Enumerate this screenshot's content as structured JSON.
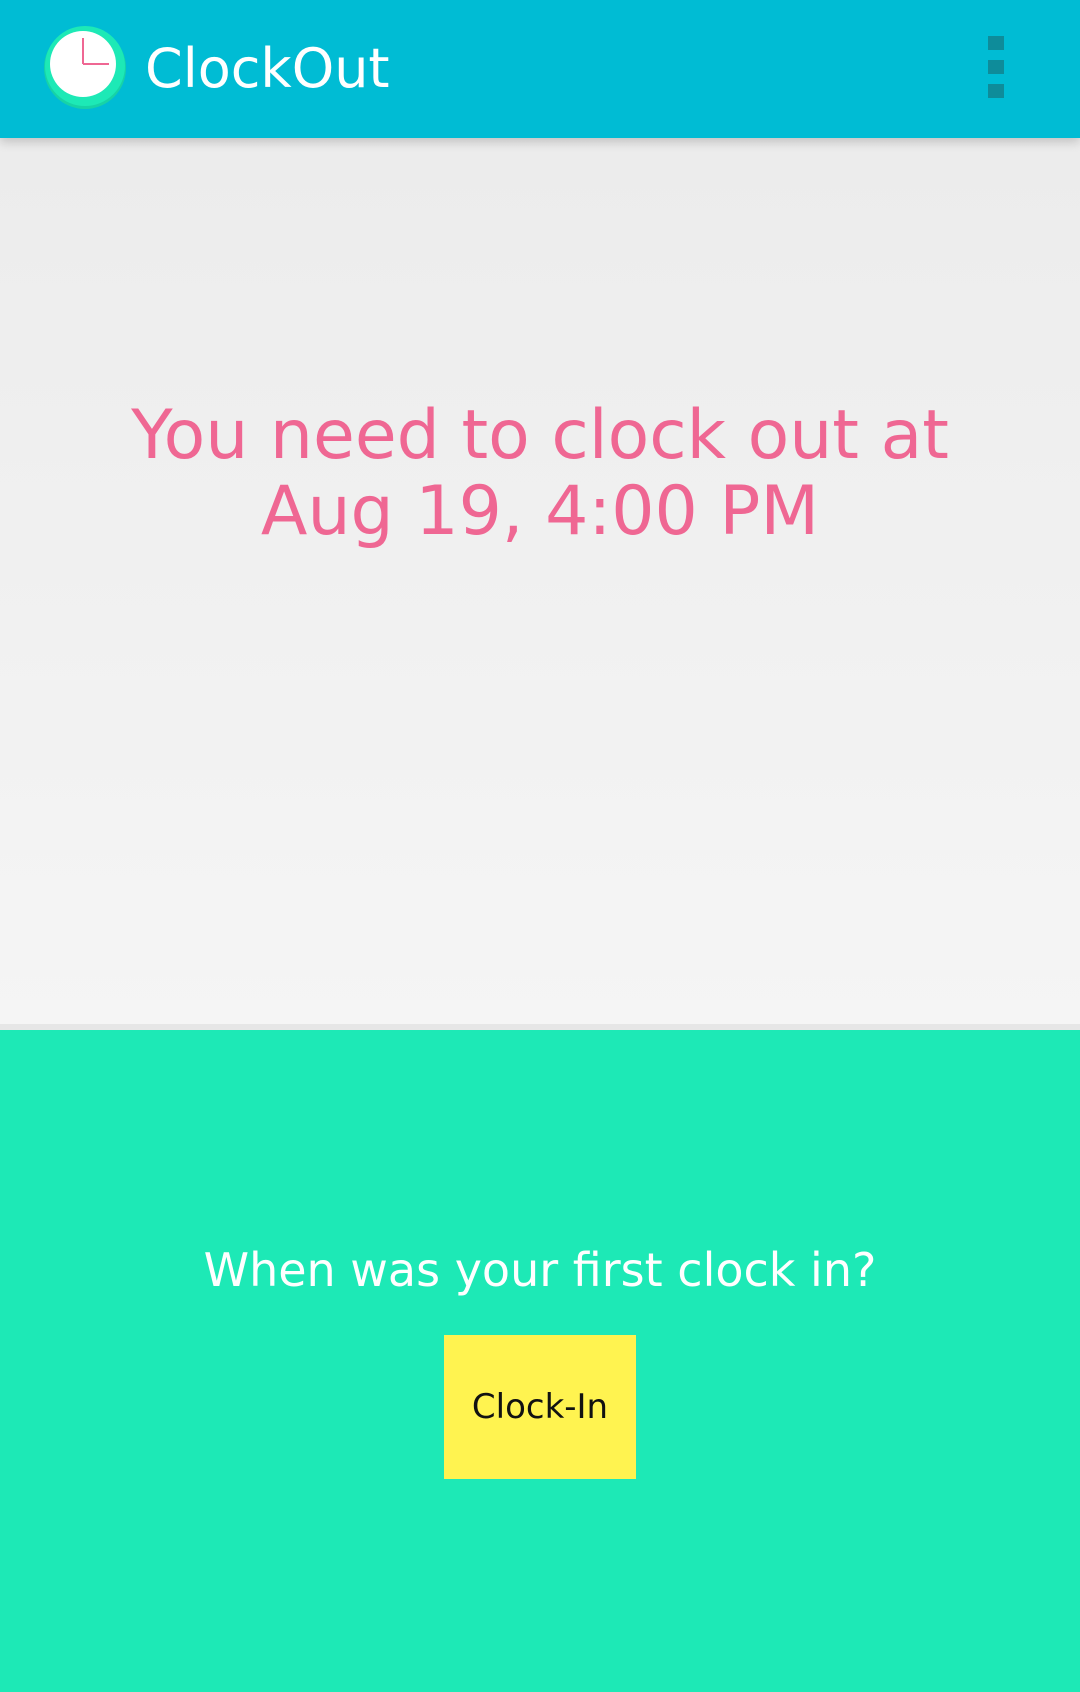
{
  "action_bar": {
    "title": "ClockOut",
    "icon": "clock-icon",
    "menu_icon": "overflow-menu-icon",
    "background_color": "#00BCD4"
  },
  "main": {
    "message_line1": "You need to clock out at",
    "message_line2": "Aug 19, 4:00 PM",
    "message_color": "#EF6793"
  },
  "bottom": {
    "question": "When was your first clock in?",
    "clock_in_label": "Clock-In",
    "background_color": "#1DE9B6",
    "button_color": "#FFF350"
  }
}
